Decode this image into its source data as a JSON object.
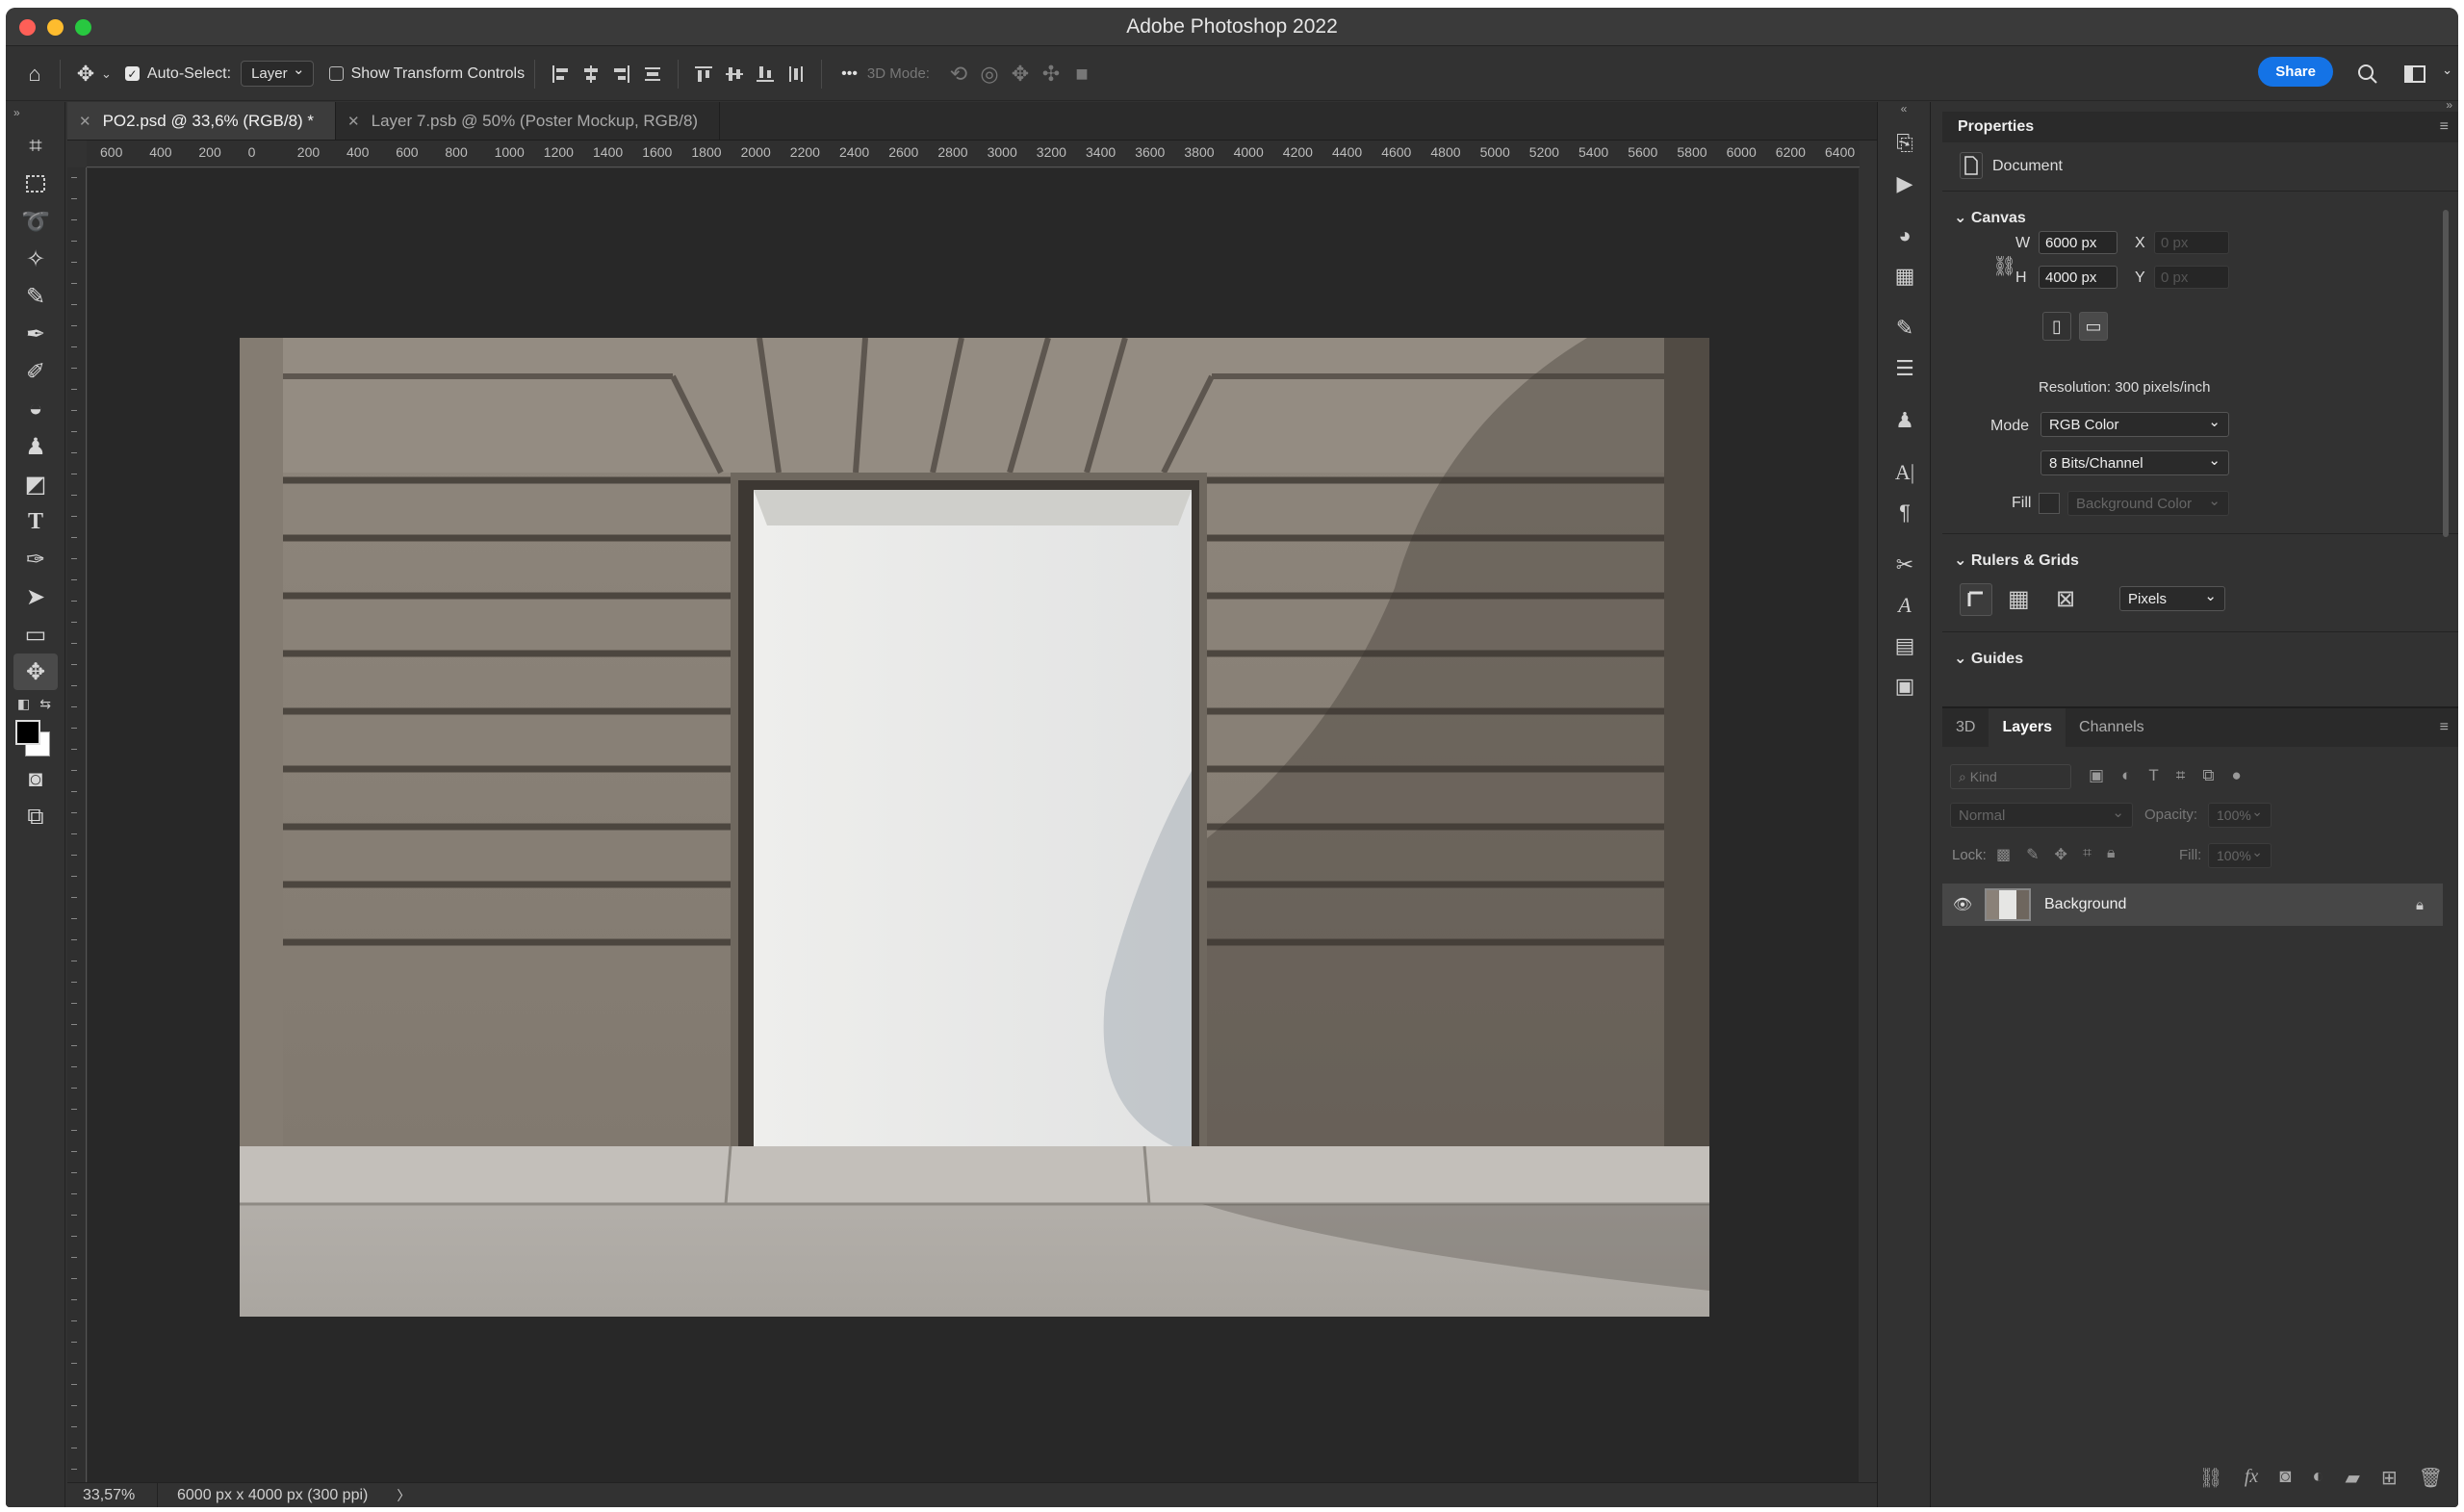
{
  "app": {
    "title": "Adobe Photoshop 2022"
  },
  "options_bar": {
    "auto_select_label": "Auto-Select:",
    "auto_select_value": "Layer",
    "show_transform_label": "Show Transform Controls",
    "mode_3d_label": "3D Mode:",
    "share_label": "Share",
    "more_label": "•••"
  },
  "doc_tabs": [
    {
      "label": "PO2.psd @ 33,6% (RGB/8) *",
      "active": true
    },
    {
      "label": "Layer 7.psb @ 50% (Poster Mockup, RGB/8)",
      "active": false
    }
  ],
  "ruler_h_ticks": [
    "600",
    "400",
    "200",
    "0",
    "200",
    "400",
    "600",
    "800",
    "1000",
    "1200",
    "1400",
    "1600",
    "1800",
    "2000",
    "2200",
    "2400",
    "2600",
    "2800",
    "3000",
    "3200",
    "3400",
    "3600",
    "3800",
    "4000",
    "4200",
    "4400",
    "4600",
    "4800",
    "5000",
    "5200",
    "5400",
    "5600",
    "5800",
    "6000",
    "6200",
    "6400"
  ],
  "status": {
    "zoom": "33,57%",
    "doc_info": "6000 px x 4000 px (300 ppi)",
    "arrow": "〉"
  },
  "properties": {
    "panel_title": "Properties",
    "doc_label": "Document",
    "canvas_title": "Canvas",
    "w_label": "W",
    "w_value": "6000 px",
    "h_label": "H",
    "h_value": "4000 px",
    "x_label": "X",
    "x_placeholder": "0 px",
    "y_label": "Y",
    "y_placeholder": "0 px",
    "resolution": "Resolution: 300 pixels/inch",
    "mode_label": "Mode",
    "mode_value": "RGB Color",
    "bits_value": "8 Bits/Channel",
    "fill_label": "Fill",
    "fill_value": "Background Color",
    "rulers_title": "Rulers & Grids",
    "units_value": "Pixels",
    "guides_title": "Guides"
  },
  "layers_panel": {
    "tabs": [
      "3D",
      "Layers",
      "Channels"
    ],
    "active_tab": "Layers",
    "kind_placeholder": "Kind",
    "blend_mode": "Normal",
    "opacity_label": "Opacity:",
    "opacity_value": "100%",
    "lock_label": "Lock:",
    "fill_label": "Fill:",
    "fill_value": "100%",
    "layers": [
      {
        "name": "Background",
        "visible": true,
        "locked": true
      }
    ]
  },
  "colors": {
    "accent": "#1473e6",
    "ui_bg": "#323232",
    "canvas_bg": "#282828"
  }
}
